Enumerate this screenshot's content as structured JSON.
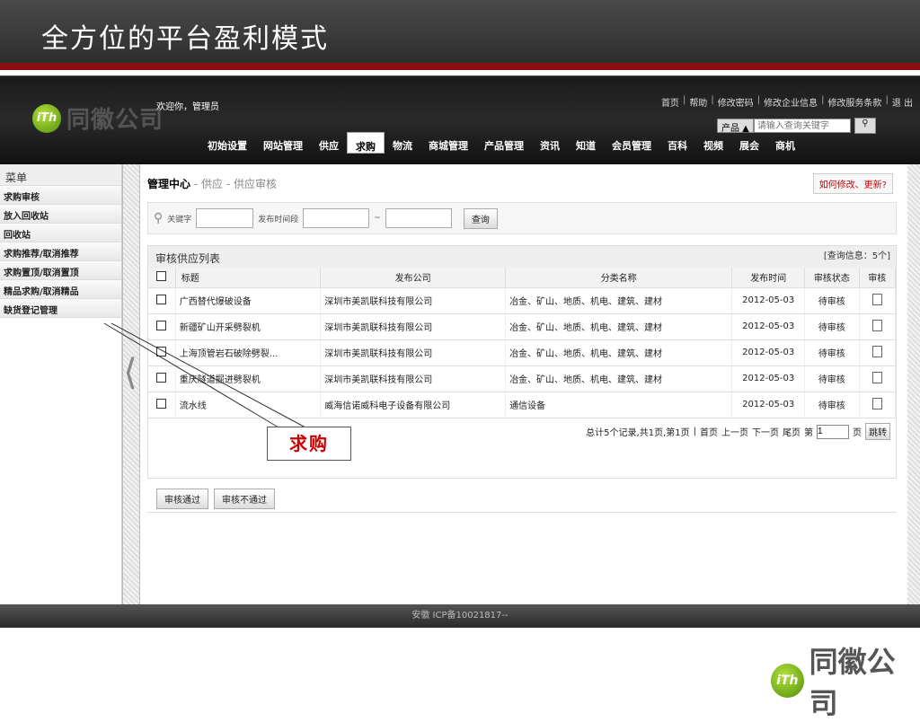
{
  "slide": {
    "title": "全方位的平台盈利模式"
  },
  "logo": {
    "mark": "iTh",
    "name": "同徽公司"
  },
  "header": {
    "welcome": "欢迎你，管理员",
    "links": [
      "首页",
      "帮助",
      "修改密码",
      "修改企业信息",
      "修改服务条款",
      "退 出"
    ],
    "search": {
      "type": "产品",
      "placeholder": "请输入查询关键字"
    },
    "nav": [
      "初始设置",
      "网站管理",
      "供应",
      "求购",
      "物流",
      "商城管理",
      "产品管理",
      "资讯",
      "知道",
      "会员管理",
      "百科",
      "视频",
      "展会",
      "商机"
    ],
    "active_nav": "求购"
  },
  "sidebar": {
    "title": "菜单",
    "items": [
      "求购审核",
      "放入回收站",
      "回收站",
      "求购推荐/取消推荐",
      "求购置顶/取消置顶",
      "精品求购/取消精品",
      "缺货登记管理"
    ]
  },
  "content": {
    "breadcrumb": {
      "root": "管理中心",
      "sub1": "- 供应",
      "sub2": "- 供应审核"
    },
    "help_link": "如何修改、更新?",
    "filter": {
      "keyword_label": "关键字",
      "date_label": "发布时间段",
      "range_sep": "~",
      "query_button": "查询"
    },
    "panel": {
      "title": "审核供应列表",
      "info": "[查询信息：5个]"
    },
    "table": {
      "headers": [
        "标题",
        "发布公司",
        "分类名称",
        "发布时间",
        "审核状态",
        "审核"
      ],
      "rows": [
        {
          "title": "广西替代爆破设备",
          "company": "深圳市美凯联科技有限公司",
          "category": "冶金、矿山、地质、机电、建筑、建材",
          "date": "2012-05-03",
          "status": "待审核"
        },
        {
          "title": "新疆矿山开采劈裂机",
          "company": "深圳市美凯联科技有限公司",
          "category": "冶金、矿山、地质、机电、建筑、建材",
          "date": "2012-05-03",
          "status": "待审核"
        },
        {
          "title": "上海顶管岩石破除劈裂...",
          "company": "深圳市美凯联科技有限公司",
          "category": "冶金、矿山、地质、机电、建筑、建材",
          "date": "2012-05-03",
          "status": "待审核"
        },
        {
          "title": "重庆隧道掘进劈裂机",
          "company": "深圳市美凯联科技有限公司",
          "category": "冶金、矿山、地质、机电、建筑、建材",
          "date": "2012-05-03",
          "status": "待审核"
        },
        {
          "title": "流水线",
          "company": "威海信诺威科电子设备有限公司",
          "category": "通信设备",
          "date": "2012-05-03",
          "status": "待审核"
        }
      ]
    },
    "pager": {
      "summary": "总计5个记录,共1页,第1页",
      "first": "首页",
      "prev": "上一页",
      "next": "下一页",
      "last": "尾页",
      "goto_prefix": "第",
      "page_value": "1",
      "goto_suffix": "页",
      "jump": "跳转"
    },
    "actions": [
      "审核通过",
      "审核不通过"
    ]
  },
  "footer": {
    "text": "安徽 ICP备10021817--"
  },
  "callout": {
    "text": "求购"
  }
}
